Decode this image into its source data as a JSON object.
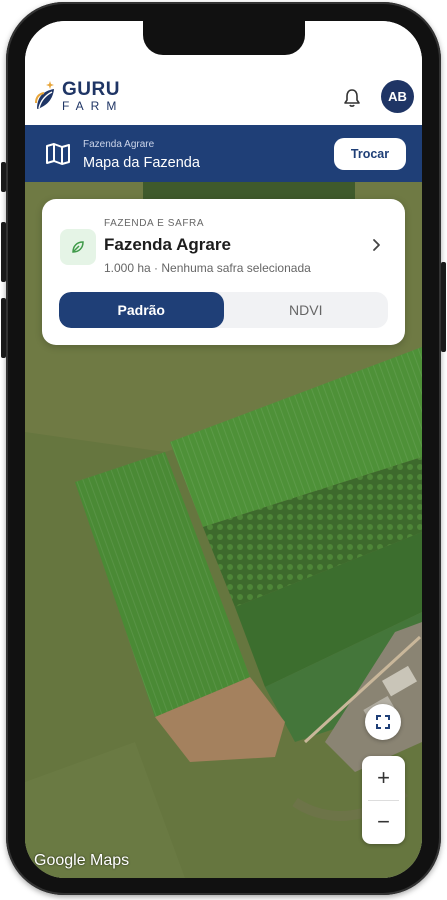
{
  "app": {
    "logo_top": "GURU",
    "logo_bottom": "FARM",
    "avatar_initials": "AB"
  },
  "farm_bar": {
    "subtitle": "Fazenda Agrare",
    "title": "Mapa da Fazenda",
    "switch_label": "Trocar"
  },
  "card": {
    "section_label": "FAZENDA E SAFRA",
    "farm_name": "Fazenda Agrare",
    "meta": "1.000 ha · Nenhuma safra selecionada",
    "tabs": [
      {
        "label": "Padrão",
        "active": true
      },
      {
        "label": "NDVI",
        "active": false
      }
    ]
  },
  "map_controls": {
    "zoom_in": "+",
    "zoom_out": "−",
    "attribution": "Google Maps"
  },
  "colors": {
    "primary": "#1f3f77",
    "logo_blue": "#1f3565",
    "leaf_green": "#3f9a49",
    "map_base": "#5f7440"
  },
  "icons": [
    "map-icon",
    "bell-icon",
    "leaf-icon",
    "chevron-right-icon",
    "fullscreen-icon"
  ]
}
